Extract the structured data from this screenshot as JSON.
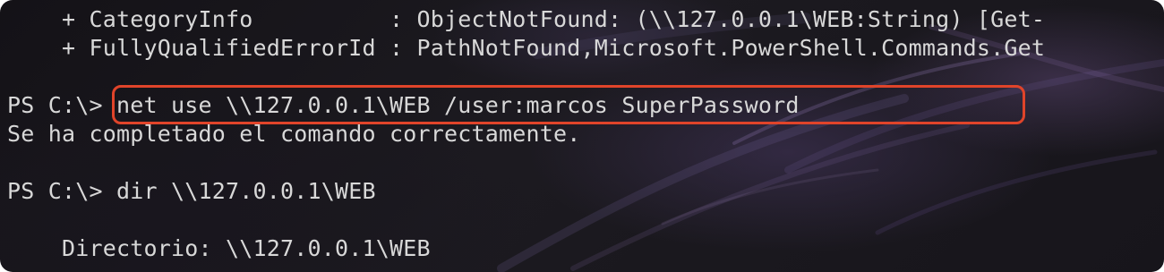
{
  "terminal": {
    "lines": {
      "line1": "    + CategoryInfo          : ObjectNotFound: (\\\\127.0.0.1\\WEB:String) [Get-",
      "line2": "    + FullyQualifiedErrorId : PathNotFound,Microsoft.PowerShell.Commands.Get",
      "line3_prompt": "PS C:\\>",
      "line3_command": " net use \\\\127.0.0.1\\WEB /user:marcos SuperPassword",
      "line4": "Se ha completado el comando correctamente.",
      "line5_prompt": "PS C:\\>",
      "line5_command": " dir \\\\127.0.0.1\\WEB",
      "line6": "    Directorio: \\\\127.0.0.1\\WEB"
    },
    "highlight_color": "#e0442a",
    "text_color": "#d8d8d8",
    "background_color": "#17151b"
  }
}
